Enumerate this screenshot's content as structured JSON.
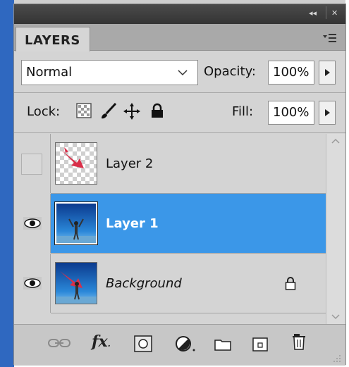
{
  "panel": {
    "tab_label": "LAYERS",
    "titlebar_glyphs": {
      "collapse": "◂◂",
      "close": "✕"
    }
  },
  "blend": {
    "mode": "Normal",
    "opacity_label": "Opacity:",
    "opacity_value": "100%"
  },
  "lock": {
    "label": "Lock:",
    "fill_label": "Fill:",
    "fill_value": "100%"
  },
  "layers": [
    {
      "name": "Layer 2",
      "visible": false,
      "selected": false,
      "italic": false,
      "locked": false
    },
    {
      "name": "Layer 1",
      "visible": true,
      "selected": true,
      "italic": false,
      "locked": false
    },
    {
      "name": "Background",
      "visible": true,
      "selected": false,
      "italic": true,
      "locked": true
    }
  ],
  "colors": {
    "selection": "#3b97e8",
    "panel_bg": "#d4d4d4",
    "title_bar": "#3c3c3c",
    "window_edge": "#2f68c0"
  },
  "footer_icons": [
    "link-layers-icon",
    "fx-icon",
    "add-mask-icon",
    "adjustment-layer-icon",
    "new-group-icon",
    "new-layer-icon",
    "delete-layer-icon"
  ],
  "footer": {
    "fx_label": "fx"
  }
}
